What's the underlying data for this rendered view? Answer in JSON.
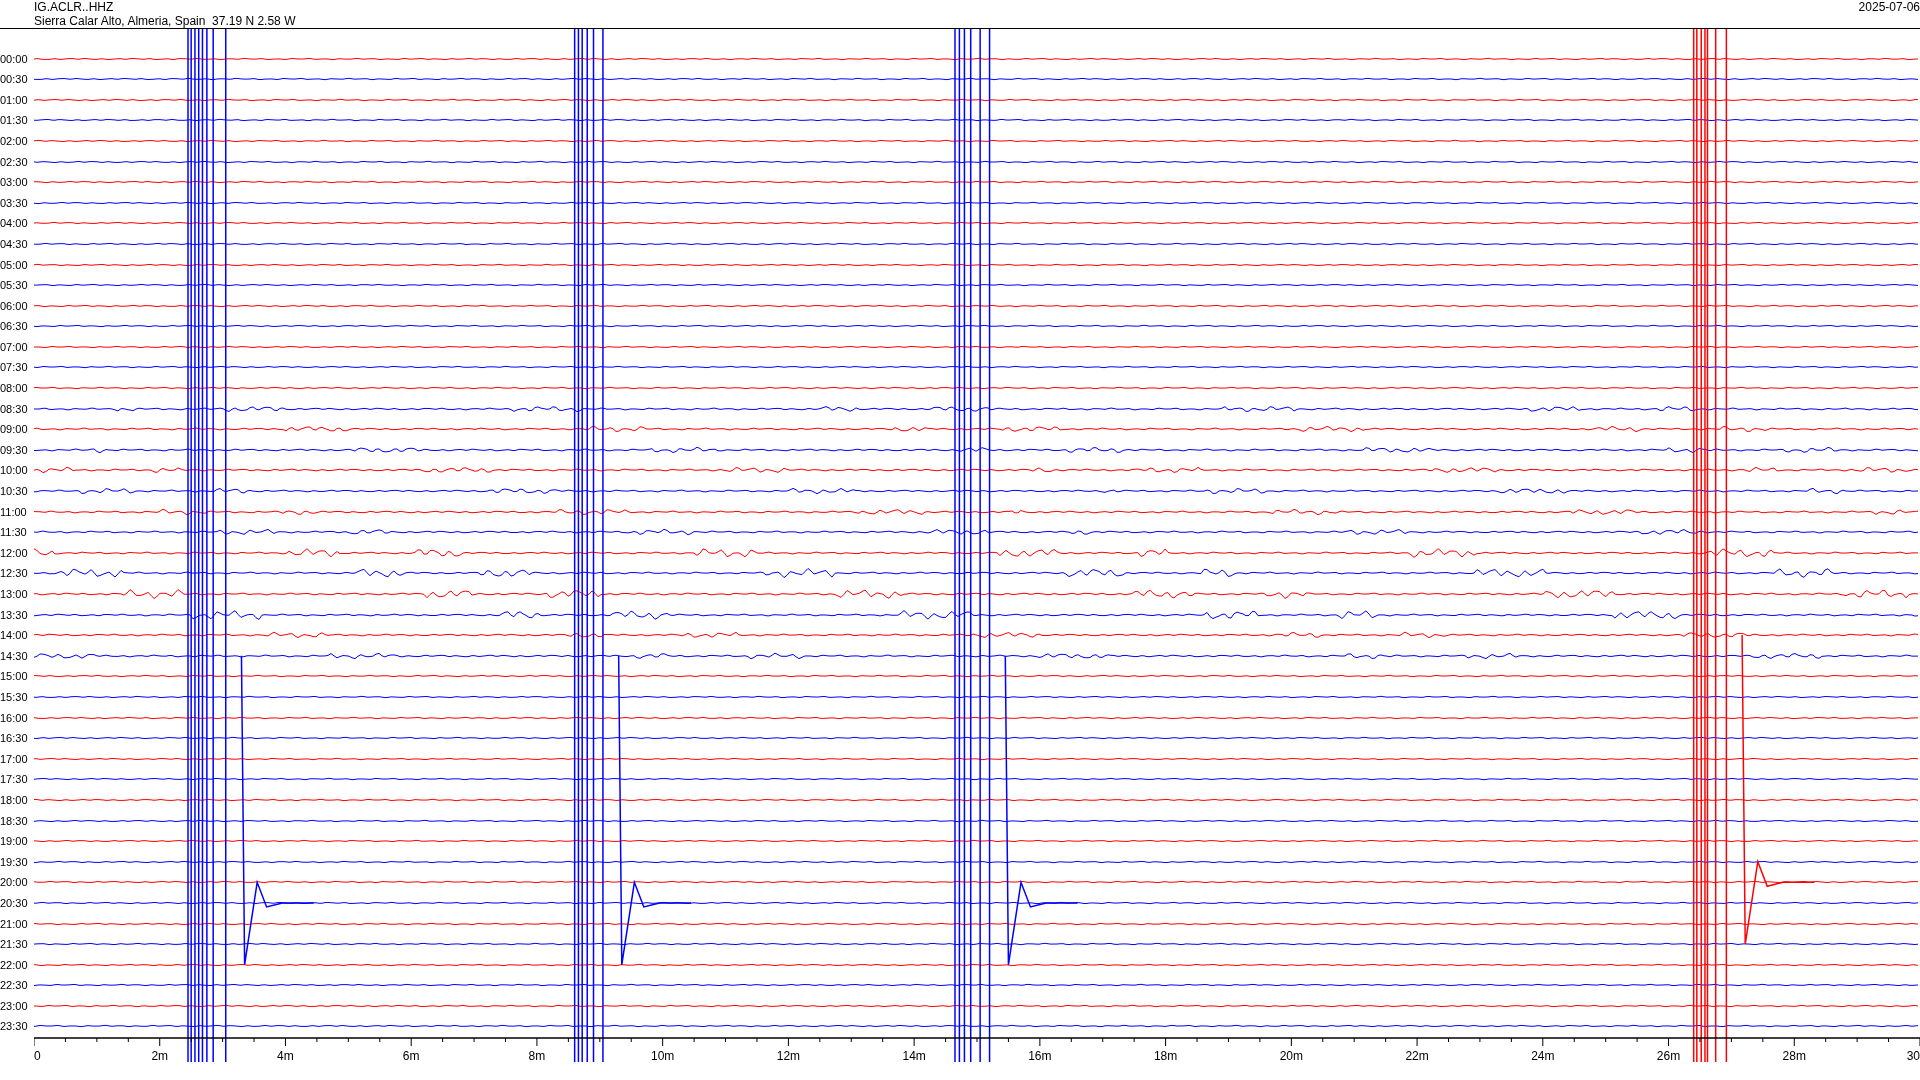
{
  "header": {
    "station": "IG.ACLR..HHZ",
    "location": "Sierra Calar Alto, Almeria, Spain  37.19 N 2.58 W",
    "date": "2025-07-06"
  },
  "rows": [
    {
      "time": "00:00",
      "color": "#ff0000"
    },
    {
      "time": "00:30",
      "color": "#0000ff"
    },
    {
      "time": "01:00",
      "color": "#ff0000"
    },
    {
      "time": "01:30",
      "color": "#0000ff"
    },
    {
      "time": "02:00",
      "color": "#ff0000"
    },
    {
      "time": "02:30",
      "color": "#0000ff"
    },
    {
      "time": "03:00",
      "color": "#ff0000"
    },
    {
      "time": "03:30",
      "color": "#0000ff"
    },
    {
      "time": "04:00",
      "color": "#ff0000"
    },
    {
      "time": "04:30",
      "color": "#0000ff"
    },
    {
      "time": "05:00",
      "color": "#ff0000"
    },
    {
      "time": "05:30",
      "color": "#0000ff"
    },
    {
      "time": "06:00",
      "color": "#ff0000"
    },
    {
      "time": "06:30",
      "color": "#0000ff"
    },
    {
      "time": "07:00",
      "color": "#ff0000"
    },
    {
      "time": "07:30",
      "color": "#0000ff"
    },
    {
      "time": "08:00",
      "color": "#ff0000"
    },
    {
      "time": "08:30",
      "color": "#0000ff"
    },
    {
      "time": "09:00",
      "color": "#ff0000"
    },
    {
      "time": "09:30",
      "color": "#0000ff"
    },
    {
      "time": "10:00",
      "color": "#ff0000"
    },
    {
      "time": "10:30",
      "color": "#0000ff"
    },
    {
      "time": "11:00",
      "color": "#ff0000"
    },
    {
      "time": "11:30",
      "color": "#0000ff"
    },
    {
      "time": "12:00",
      "color": "#ff0000"
    },
    {
      "time": "12:30",
      "color": "#0000ff"
    },
    {
      "time": "13:00",
      "color": "#ff0000"
    },
    {
      "time": "13:30",
      "color": "#0000ff"
    },
    {
      "time": "14:00",
      "color": "#ff0000"
    },
    {
      "time": "14:30",
      "color": "#0000ff"
    },
    {
      "time": "15:00",
      "color": "#ff0000"
    },
    {
      "time": "15:30",
      "color": "#0000ff"
    },
    {
      "time": "16:00",
      "color": "#ff0000"
    },
    {
      "time": "16:30",
      "color": "#0000ff"
    },
    {
      "time": "17:00",
      "color": "#ff0000"
    },
    {
      "time": "17:30",
      "color": "#0000ff"
    },
    {
      "time": "18:00",
      "color": "#ff0000"
    },
    {
      "time": "18:30",
      "color": "#0000ff"
    },
    {
      "time": "19:00",
      "color": "#ff0000"
    },
    {
      "time": "19:30",
      "color": "#0000ff"
    },
    {
      "time": "20:00",
      "color": "#ff0000"
    },
    {
      "time": "20:30",
      "color": "#0000ff"
    },
    {
      "time": "21:00",
      "color": "#ff0000"
    },
    {
      "time": "21:30",
      "color": "#0000ff"
    },
    {
      "time": "22:00",
      "color": "#ff0000"
    },
    {
      "time": "22:30",
      "color": "#0000ff"
    },
    {
      "time": "23:00",
      "color": "#ff0000"
    },
    {
      "time": "23:30",
      "color": "#0000ff"
    }
  ],
  "x_axis": {
    "labels": [
      "0",
      "2m",
      "4m",
      "6m",
      "8m",
      "10m",
      "12m",
      "14m",
      "16m",
      "18m",
      "20m",
      "22m",
      "24m",
      "26m",
      "28m",
      "30"
    ]
  }
}
